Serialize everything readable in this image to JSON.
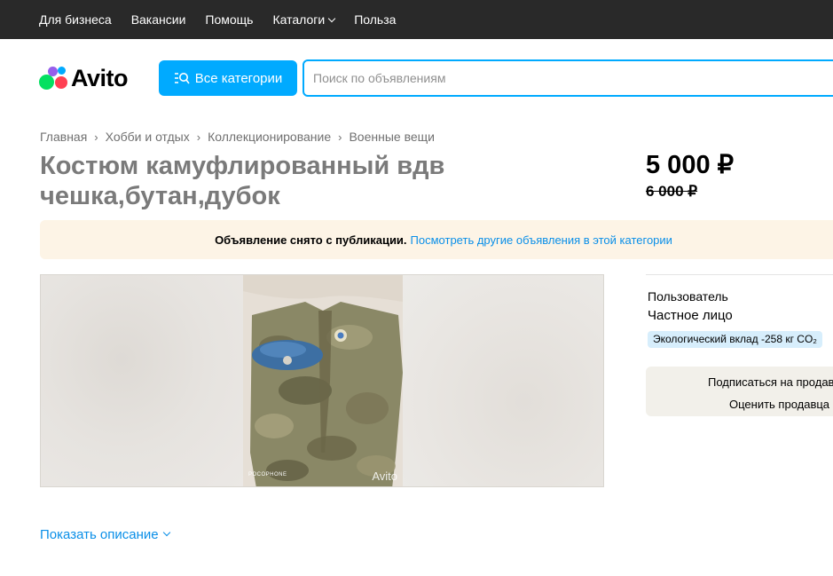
{
  "topnav": {
    "items": [
      "Для бизнеса",
      "Вакансии",
      "Помощь",
      "Каталоги",
      "Польза"
    ]
  },
  "header": {
    "logo_text": "Avito",
    "categories_button": "Все категории",
    "search_placeholder": "Поиск по объявлениям"
  },
  "breadcrumbs": [
    "Главная",
    "Хобби и отдых",
    "Коллекционирование",
    "Военные вещи"
  ],
  "listing": {
    "title": "Костюм камуфлированный вдв чешка,бутан,дубок",
    "price": "5 000 ₽",
    "old_price": "6 000 ₽"
  },
  "notice": {
    "text": "Объявление снято с публикации.",
    "link": "Посмотреть другие объявления в этой категории"
  },
  "seller": {
    "label": "Пользователь",
    "type": "Частное лицо",
    "eco_badge": "Экологический вклад -258 кг CO₂",
    "subscribe": "Подписаться на продавца",
    "rate": "Оценить продавца"
  },
  "photo": {
    "watermark": "Avito",
    "phone_tag": "POCOPHONE"
  },
  "description": {
    "show_label": "Показать описание"
  },
  "colors": {
    "topbar": "#292929",
    "accent": "#00aaff",
    "link": "#0a8fe8",
    "notice_bg": "#fdf4e6",
    "badge_bg": "#d7eefc"
  }
}
